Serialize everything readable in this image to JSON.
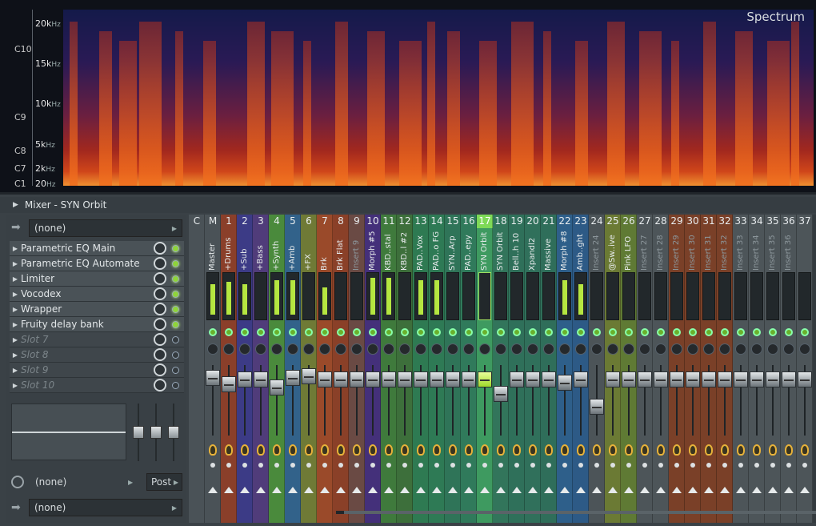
{
  "spectrum": {
    "title": "Spectrum",
    "note_labels": [
      "C10",
      "C9",
      "C8",
      "C7",
      "C1"
    ],
    "hz_labels": [
      {
        "num": "20k",
        "unit": "Hz"
      },
      {
        "num": "15k",
        "unit": "Hz"
      },
      {
        "num": "10k",
        "unit": "Hz"
      },
      {
        "num": "5k",
        "unit": "Hz"
      },
      {
        "num": "2k",
        "unit": "Hz"
      },
      {
        "num": "20",
        "unit": "Hz"
      }
    ]
  },
  "mixer": {
    "title": "Mixer - SYN Orbit",
    "input_select": "(none)",
    "slots": [
      {
        "label": "Parametric EQ Main",
        "empty": false
      },
      {
        "label": "Parametric EQ Automate",
        "empty": false
      },
      {
        "label": "Limiter",
        "empty": false
      },
      {
        "label": "Vocodex",
        "empty": false
      },
      {
        "label": "Wrapper",
        "empty": false
      },
      {
        "label": "Fruity delay bank",
        "empty": false
      },
      {
        "label": "Slot 7",
        "empty": true
      },
      {
        "label": "Slot 8",
        "empty": true
      },
      {
        "label": "Slot 9",
        "empty": true
      },
      {
        "label": "Slot 10",
        "empty": true
      }
    ],
    "routing_label": "(none)",
    "post_label": "Post",
    "output_select": "(none)",
    "strips": [
      {
        "num": "C",
        "name": "",
        "color": "#4a5257",
        "level": 0
      },
      {
        "num": "M",
        "name": "Master",
        "color": "#4a5257",
        "level": 0.8
      },
      {
        "num": "1",
        "name": "+Drums",
        "color": "#8a3f2a",
        "level": 0.85
      },
      {
        "num": "2",
        "name": "+Sub",
        "color": "#3c3b86",
        "level": 0.8
      },
      {
        "num": "3",
        "name": "+Bass",
        "color": "#503c7a",
        "level": 0
      },
      {
        "num": "4",
        "name": "+Synth",
        "color": "#4a8a3c",
        "level": 0.9
      },
      {
        "num": "5",
        "name": "+Amb",
        "color": "#32628a",
        "level": 0.9
      },
      {
        "num": "6",
        "name": "+FX",
        "color": "#6f7a36",
        "level": 0
      },
      {
        "num": "7",
        "name": "Brk",
        "color": "#9a4a2a",
        "level": 0.7
      },
      {
        "num": "8",
        "name": "Brk Flat",
        "color": "#8a4028",
        "level": 0
      },
      {
        "num": "9",
        "name": "Insert 9",
        "color": "#6a4a44",
        "level": 0
      },
      {
        "num": "10",
        "name": "Morph #5",
        "color": "#44307a",
        "level": 0.95
      },
      {
        "num": "11",
        "name": "KBD..stal",
        "color": "#3f7a3c",
        "level": 0.95
      },
      {
        "num": "12",
        "name": "KBD..l #2",
        "color": "#3d6f3b",
        "level": 0
      },
      {
        "num": "13",
        "name": "PAD..Vox",
        "color": "#2e7a52",
        "level": 0.9
      },
      {
        "num": "14",
        "name": "PAD..o FG",
        "color": "#2e7a55",
        "level": 0.9
      },
      {
        "num": "15",
        "name": "SYN..Arp",
        "color": "#2f7458",
        "level": 0
      },
      {
        "num": "16",
        "name": "PAD..epy",
        "color": "#307a5b",
        "level": 0
      },
      {
        "num": "17",
        "name": "SYN Orbit",
        "color": "#3e9a60",
        "level": 0
      },
      {
        "num": "18",
        "name": "SYN Orbit",
        "color": "#32755b",
        "level": 0
      },
      {
        "num": "19",
        "name": "Bell..h 10",
        "color": "#2f705a",
        "level": 0
      },
      {
        "num": "20",
        "name": "Xpandl2",
        "color": "#30705b",
        "level": 0
      },
      {
        "num": "21",
        "name": "Massive",
        "color": "#2f6e5a",
        "level": 0
      },
      {
        "num": "22",
        "name": "Morph #8",
        "color": "#2e5f8a",
        "level": 0.9
      },
      {
        "num": "23",
        "name": "Amb..ght",
        "color": "#2d5a86",
        "level": 0.8
      },
      {
        "num": "24",
        "name": "Insert 24",
        "color": "#4c5458",
        "level": 0
      },
      {
        "num": "25",
        "name": "@Sw..ive",
        "color": "#6b7a34",
        "level": 0
      },
      {
        "num": "26",
        "name": "Pink LFO",
        "color": "#5f7a34",
        "level": 0
      },
      {
        "num": "27",
        "name": "Insert 27",
        "color": "#4d5559",
        "level": 0
      },
      {
        "num": "28",
        "name": "Insert 28",
        "color": "#4d5559",
        "level": 0
      },
      {
        "num": "29",
        "name": "Insert 29",
        "color": "#7a4028",
        "level": 0
      },
      {
        "num": "30",
        "name": "Insert 30",
        "color": "#7a4028",
        "level": 0
      },
      {
        "num": "31",
        "name": "Insert 31",
        "color": "#7a4028",
        "level": 0
      },
      {
        "num": "32",
        "name": "Insert 32",
        "color": "#7a4028",
        "level": 0
      },
      {
        "num": "33",
        "name": "Insert 33",
        "color": "#4d5559",
        "level": 0
      },
      {
        "num": "34",
        "name": "Insert 34",
        "color": "#4d5559",
        "level": 0
      },
      {
        "num": "35",
        "name": "Insert 35",
        "color": "#4d5559",
        "level": 0
      },
      {
        "num": "36",
        "name": "Insert 36",
        "color": "#4d5559",
        "level": 0
      },
      {
        "num": "37",
        "name": "",
        "color": "#4d5559",
        "level": 0
      }
    ]
  }
}
